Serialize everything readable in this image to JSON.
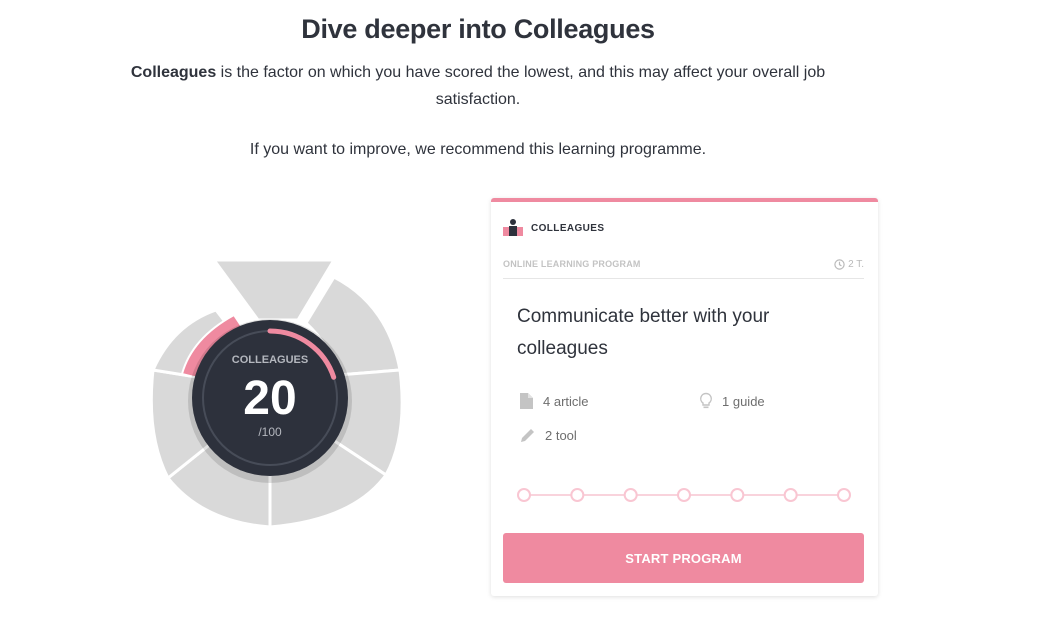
{
  "header": {
    "title": "Dive deeper into Colleagues",
    "intro_bold": "Colleagues",
    "intro_text": " is the factor on which you have scored the lowest, and this may affect your overall job satisfaction.",
    "recommend": "If you want to improve, we recommend this learning programme."
  },
  "score": {
    "label": "COLLEAGUES",
    "value": "20",
    "max": "/100",
    "fraction": 0.2
  },
  "wheel": {
    "segment_color": "#d9d9d9",
    "highlight_color": "#ef8aa0",
    "center_color": "#2d313c"
  },
  "card": {
    "category": "COLLEAGUES",
    "type": "ONLINE LEARNING PROGRAM",
    "duration": "2 T.",
    "title": "Communicate better with your colleagues",
    "stats": {
      "articles": "4 article",
      "guides": "1 guide",
      "tools": "2 tool"
    },
    "progress_steps": 7,
    "button": "START PROGRAM",
    "accent": "#ef8aa0"
  }
}
